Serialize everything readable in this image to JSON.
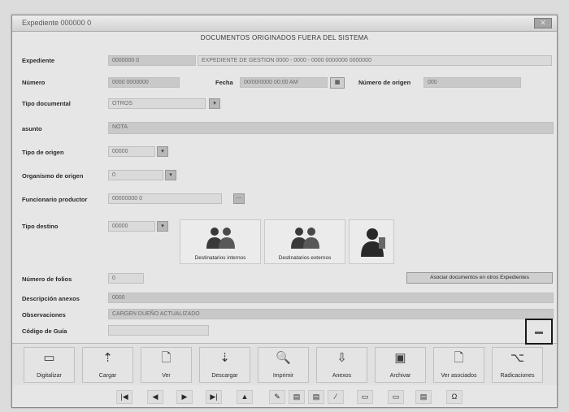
{
  "window": {
    "title": "Expediente 000000 0",
    "close_label": "✕"
  },
  "form": {
    "title": "DOCUMENTOS ORIGINADOS FUERA DEL SISTEMA"
  },
  "fields": {
    "expediente": {
      "label": "Expediente",
      "code": "0000000 0",
      "description": "EXPEDIENTE DE GESTION 0000 - 0000 - 0000 0000000 0000000"
    },
    "numero": {
      "label": "Número",
      "value": "0000 0000000"
    },
    "fecha": {
      "label": "Fecha",
      "value": "00/00/0000 00:00 AM",
      "calendar": "▦"
    },
    "numero_origen": {
      "label": "Número de origen",
      "value": "000"
    },
    "tipo_documental": {
      "label": "Tipo documental",
      "value": "OTROS"
    },
    "asunto": {
      "label": "asunto",
      "value": "NOTA"
    },
    "tipo_origen": {
      "label": "Tipo de origen",
      "value": "00000"
    },
    "organismo_origen": {
      "label": "Organismo de origen",
      "value": "0"
    },
    "funcionario_productor": {
      "label": "Funcionario productor",
      "value": "00000000 0"
    },
    "tipo_destino": {
      "label": "Tipo destino",
      "value": "00000"
    },
    "numero_folios": {
      "label": "Número de folios",
      "value": "0"
    },
    "descripcion_anexos": {
      "label": "Descripción anexos",
      "value": "0000"
    },
    "observaciones": {
      "label": "Observaciones",
      "value": "CARGEN DUEÑO ACTUALIZADO"
    },
    "codigo_guia": {
      "label": "Código de Guía",
      "value": ""
    }
  },
  "destinatarios": {
    "interno_label": "Destinatarios internos",
    "externo_label": "Destinatarios externos"
  },
  "asociar_button": "Asociar documentos en otros Expedientes",
  "toolbar": [
    {
      "icon": "digitalizar-icon",
      "label": "Digitalizar"
    },
    {
      "icon": "upload-icon",
      "label": "Cargar"
    },
    {
      "icon": "view-document-icon",
      "label": "Ver"
    },
    {
      "icon": "download-icon",
      "label": "Descargar"
    },
    {
      "icon": "print-icon",
      "label": "Imprimir"
    },
    {
      "icon": "annex-icon",
      "label": "Anexos"
    },
    {
      "icon": "archive-icon",
      "label": "Archivar"
    },
    {
      "icon": "version-icon",
      "label": "Ver asociados"
    },
    {
      "icon": "network-icon",
      "label": "Radicaciones"
    }
  ],
  "toolbar_glyphs": [
    "▭",
    "⇡",
    "🗋",
    "⇣",
    "🔍",
    "⇩",
    "▣",
    "🗋",
    "⌥"
  ],
  "nav": [
    "|◀",
    "◀",
    "▶",
    "▶|",
    "▲",
    "✎",
    "▤",
    "▤",
    "⁄",
    "▭",
    "▭",
    "▤",
    "Ω"
  ]
}
